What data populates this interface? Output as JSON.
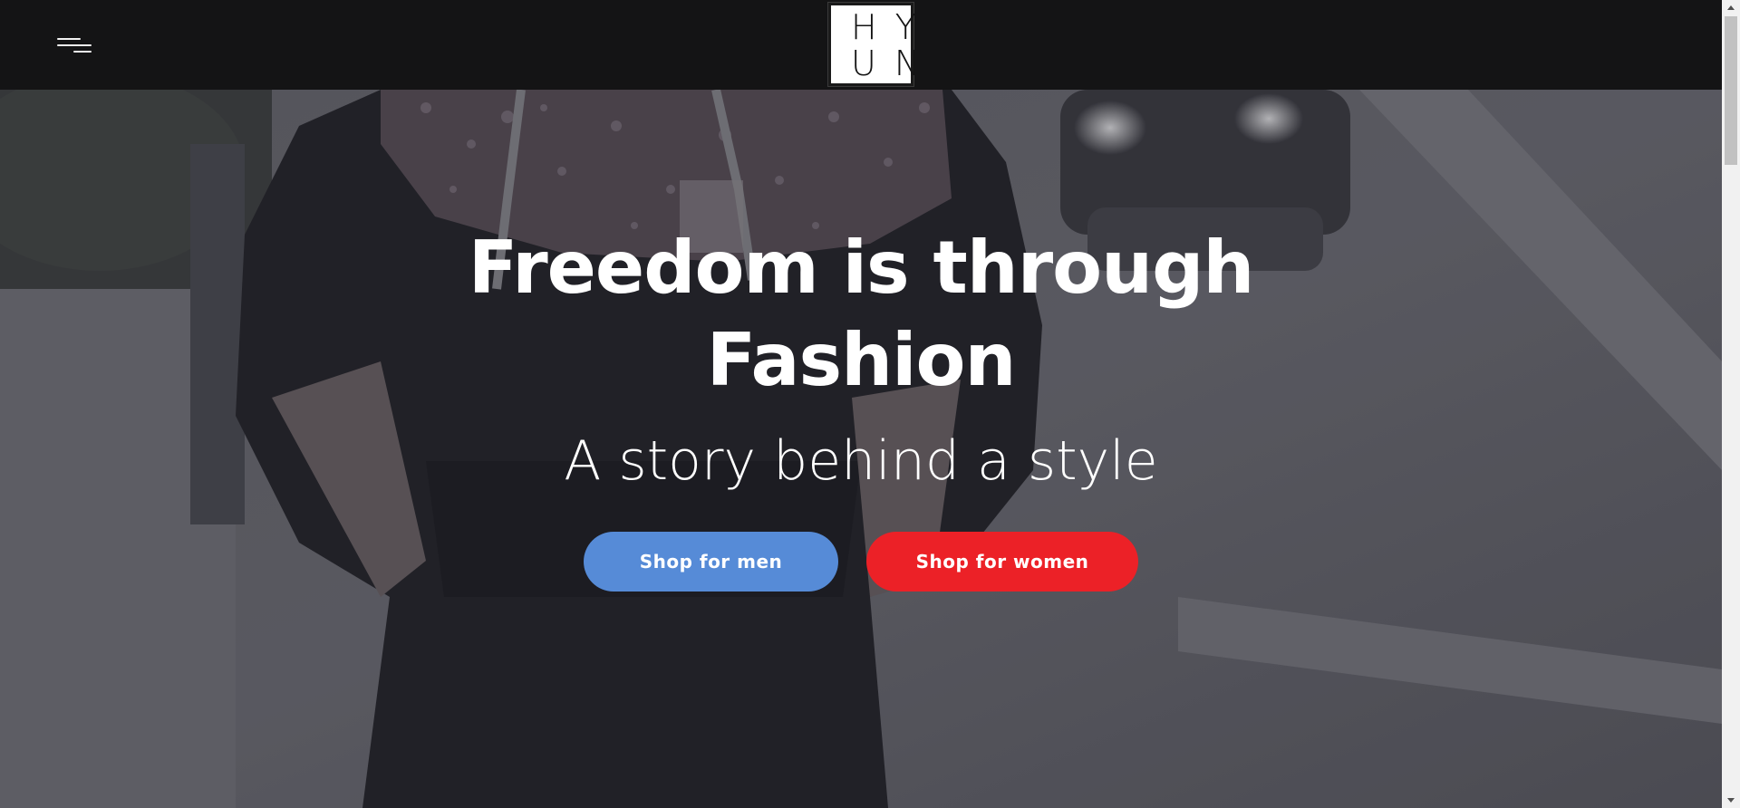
{
  "header": {
    "logo_row1": "HY",
    "logo_row2": "UN",
    "menu_icon": "hamburger-menu-icon"
  },
  "hero": {
    "title_line1": "Freedom is through",
    "title_line2": "Fashion",
    "subtitle": "A story behind a style",
    "background_image": "person-in-dark-hoodie-on-street-photo",
    "buttons": {
      "men_label": "Shop for men",
      "women_label": "Shop for women"
    }
  },
  "colors": {
    "header_bg": "#141415",
    "men_button": "#568bd7",
    "women_button": "#ec2127",
    "text": "#ffffff"
  }
}
